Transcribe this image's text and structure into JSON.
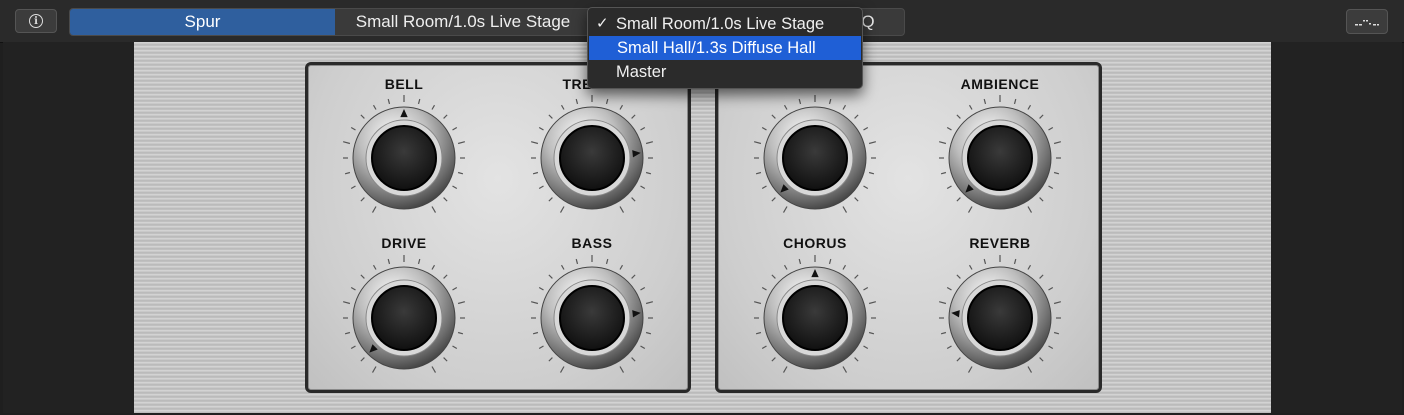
{
  "toolbar": {
    "info_icon": "info-icon",
    "tab_active": "Spur",
    "tab_preset": "Small Room/1.0s Live Stage",
    "tab_eq": "EQ",
    "menu_icon": "dotted-menu-icon"
  },
  "dropdown": {
    "items": [
      {
        "label": "Small Room/1.0s Live Stage",
        "checked": true,
        "check_glyph": "✓"
      },
      {
        "label": "Small Hall/1.3s Diffuse Hall",
        "highlighted": true
      },
      {
        "label": "Master"
      }
    ]
  },
  "knobs": [
    {
      "name": "bell",
      "label": "BELL",
      "level": 0.5
    },
    {
      "name": "treble",
      "label": "TREBLE",
      "level": 0.78
    },
    {
      "name": "drive",
      "label": "DRIVE",
      "level": 0.05
    },
    {
      "name": "bass",
      "label": "BASS",
      "level": 0.78
    },
    {
      "name": "knob-unlabeled",
      "label": "",
      "level": 0.05
    },
    {
      "name": "ambience",
      "label": "AMBIENCE",
      "level": 0.05
    },
    {
      "name": "chorus",
      "label": "CHORUS",
      "level": 0.5
    },
    {
      "name": "reverb",
      "label": "REVERB",
      "level": 0.22
    }
  ],
  "colors": {
    "accent_segment": "#2f5f9e",
    "menu_highlight": "#1f5fd6"
  }
}
